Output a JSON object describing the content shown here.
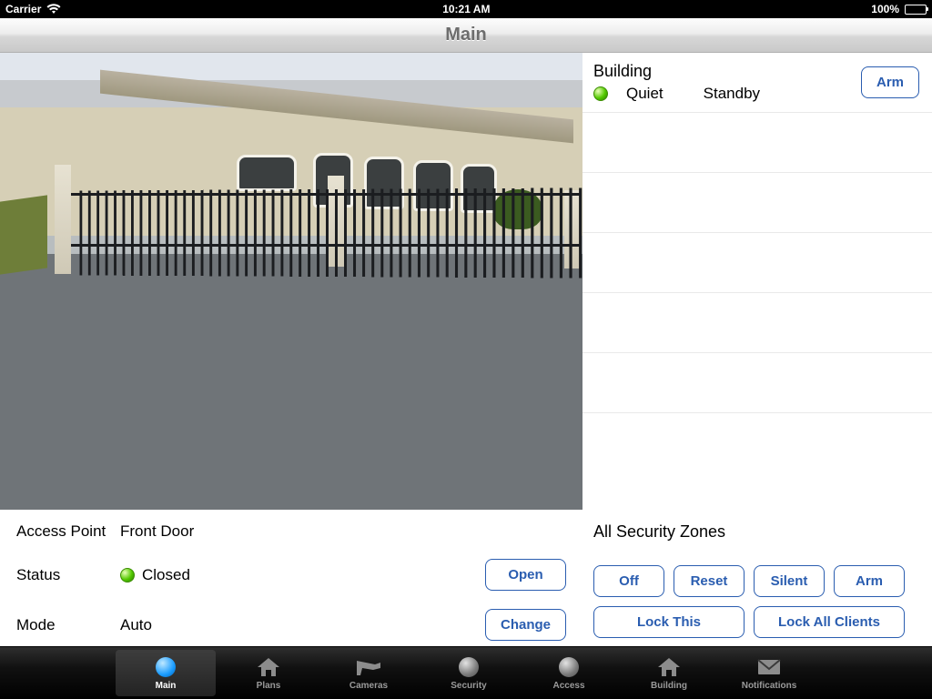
{
  "statusbar": {
    "carrier": "Carrier",
    "time": "10:21 AM",
    "battery_pct": "100%"
  },
  "navbar": {
    "title": "Main"
  },
  "zone": {
    "name": "Building",
    "status": "Quiet",
    "mode": "Standby",
    "arm_label": "Arm"
  },
  "access": {
    "point_label": "Access Point",
    "point_value": "Front Door",
    "status_label": "Status",
    "status_value": "Closed",
    "mode_label": "Mode",
    "mode_value": "Auto",
    "open_btn": "Open",
    "change_btn": "Change"
  },
  "allzones": {
    "title": "All Security Zones",
    "off": "Off",
    "reset": "Reset",
    "silent": "Silent",
    "arm": "Arm",
    "lock_this": "Lock This",
    "lock_all": "Lock All Clients"
  },
  "tabs": {
    "main": "Main",
    "plans": "Plans",
    "cameras": "Cameras",
    "security": "Security",
    "access": "Access",
    "building": "Building",
    "notifications": "Notifications"
  }
}
